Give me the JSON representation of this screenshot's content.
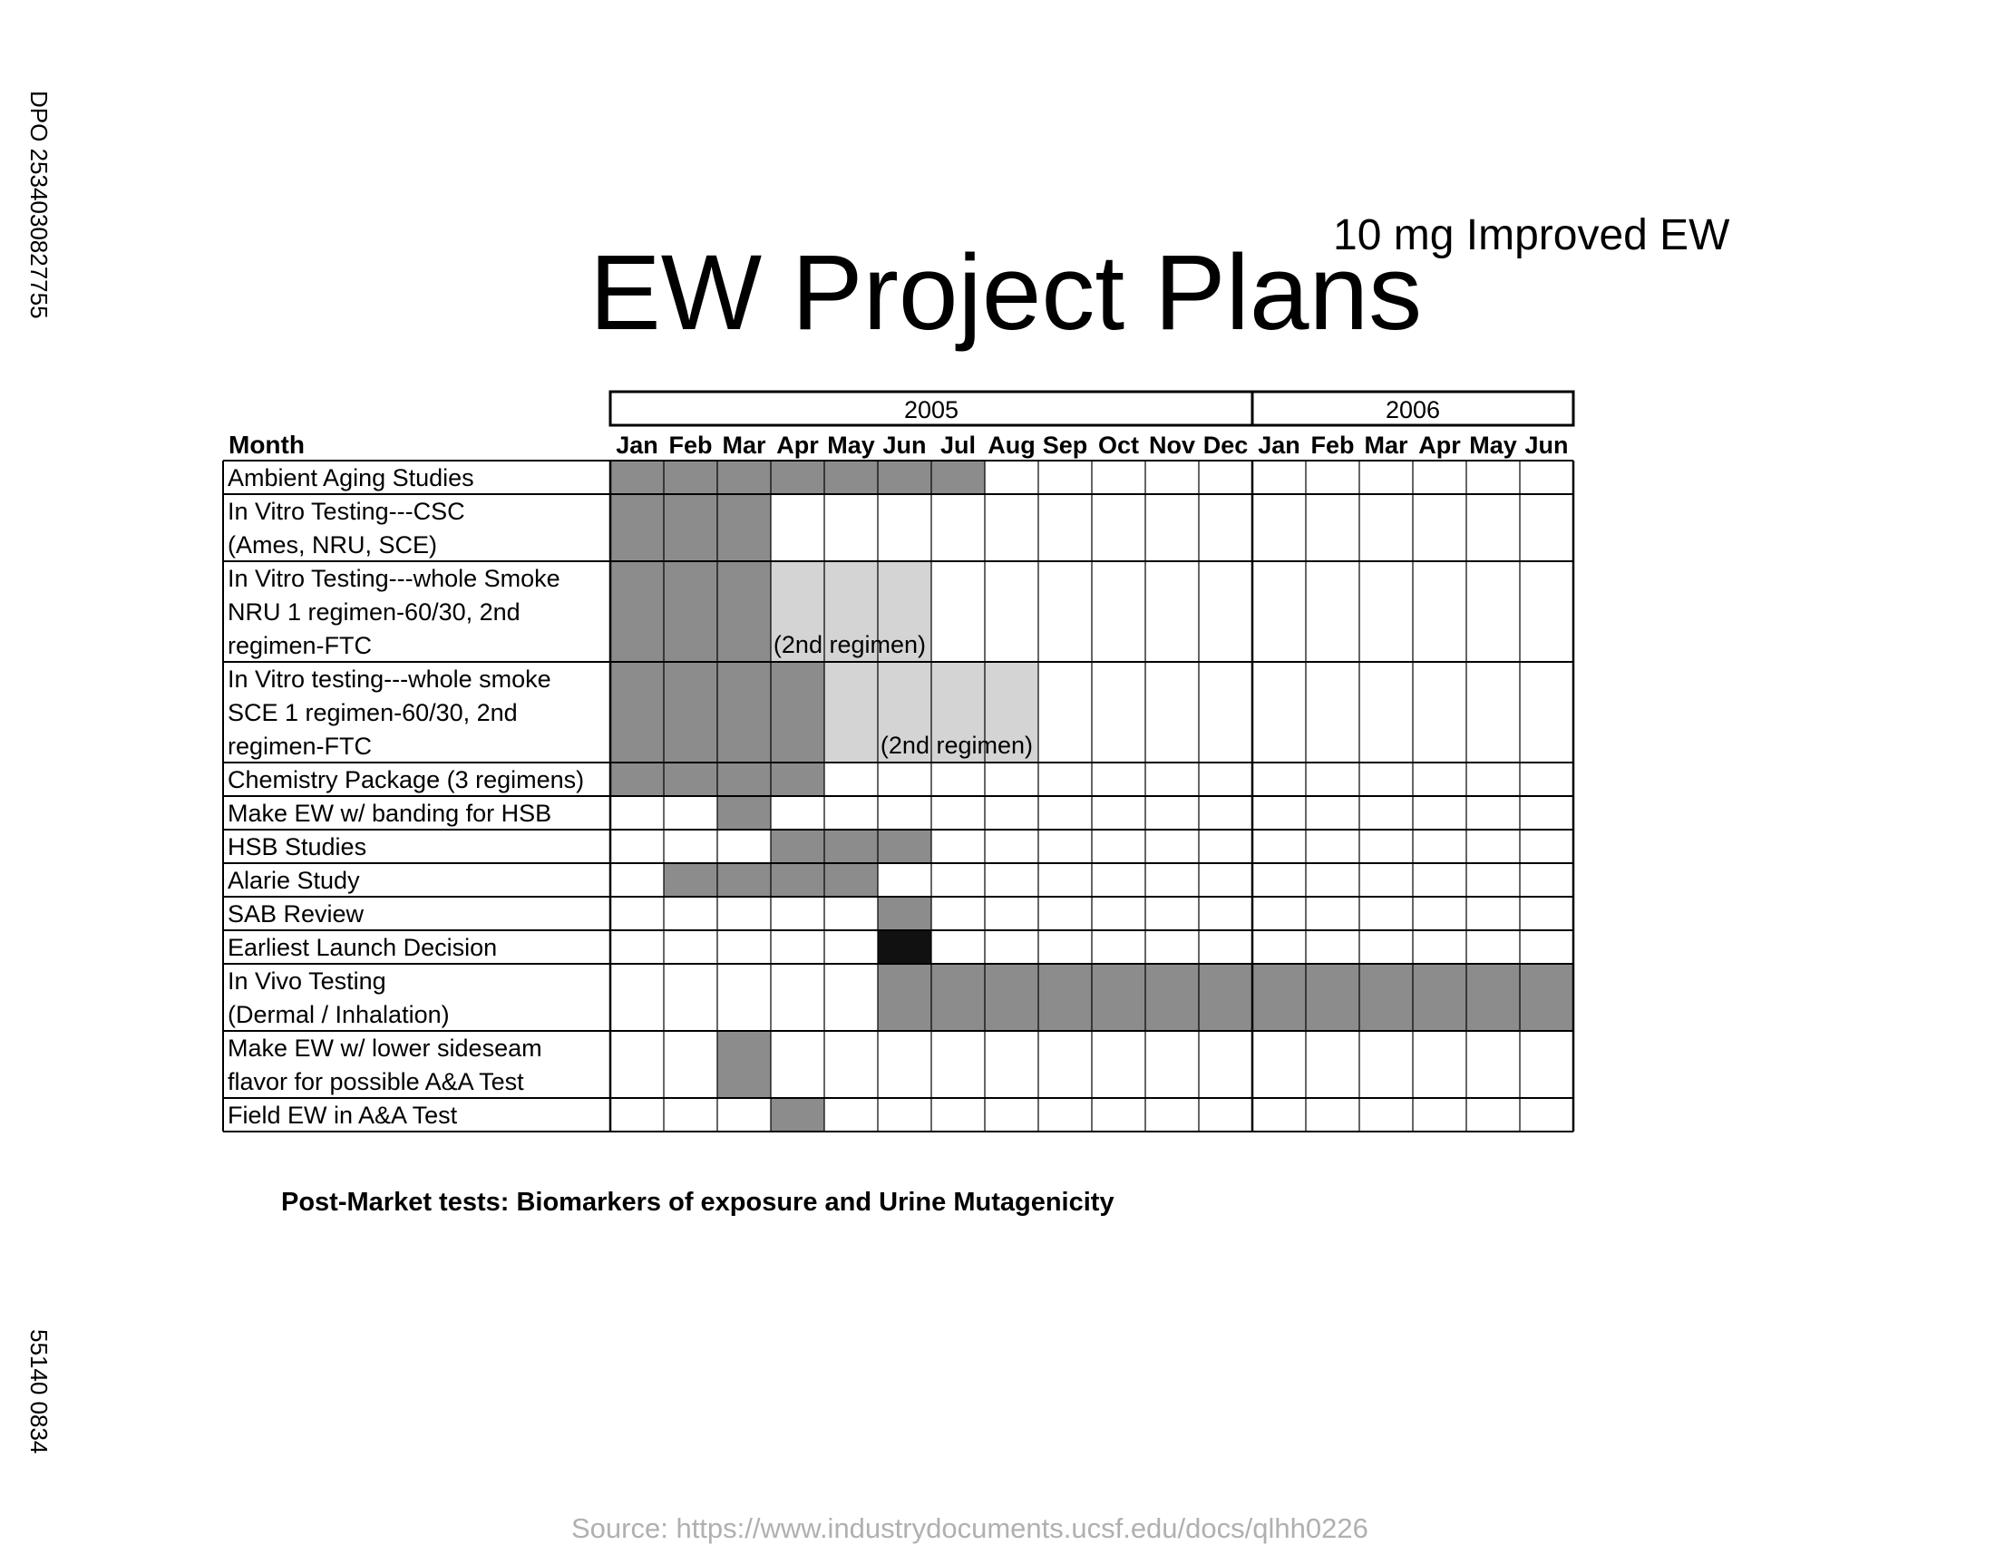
{
  "doc_id_top": "DPO 2534030827755",
  "doc_id_bottom": "55140 0834",
  "subtitle": "10 mg Improved EW",
  "title": "EW Project Plans",
  "table": {
    "month_header": "Month",
    "years": [
      {
        "label": "2005",
        "months": 12
      },
      {
        "label": "2006",
        "months": 6
      }
    ],
    "months": [
      "Jan",
      "Feb",
      "Mar",
      "Apr",
      "May",
      "Jun",
      "Jul",
      "Aug",
      "Sep",
      "Oct",
      "Nov",
      "Dec",
      "Jan",
      "Feb",
      "Mar",
      "Apr",
      "May",
      "Jun"
    ],
    "colors": {
      "dark": "#8c8c8c",
      "light": "#d4d4d4",
      "black": "#111111"
    },
    "rows": [
      {
        "lines": [
          "Ambient Aging Studies"
        ],
        "bars": [
          {
            "start": 0,
            "end": 6,
            "shade": "dark"
          }
        ]
      },
      {
        "lines": [
          "In Vitro Testing---CSC",
          "(Ames, NRU, SCE)"
        ],
        "bars": [
          {
            "start": 0,
            "end": 2,
            "shade": "dark"
          }
        ]
      },
      {
        "lines": [
          "In Vitro Testing---whole Smoke",
          "NRU 1 regimen-60/30, 2nd",
          "regimen-FTC"
        ],
        "bars": [
          {
            "start": 0,
            "end": 2,
            "shade": "dark"
          },
          {
            "start": 3,
            "end": 5,
            "shade": "light",
            "note": "(2nd regimen)"
          }
        ]
      },
      {
        "lines": [
          "In Vitro testing---whole smoke",
          "SCE 1 regimen-60/30, 2nd",
          "regimen-FTC"
        ],
        "bars": [
          {
            "start": 0,
            "end": 3,
            "shade": "dark"
          },
          {
            "start": 4,
            "end": 7,
            "shade": "light",
            "note": "(2nd regimen)"
          }
        ]
      },
      {
        "lines": [
          "Chemistry Package (3 regimens)"
        ],
        "bars": [
          {
            "start": 0,
            "end": 3,
            "shade": "dark"
          }
        ]
      },
      {
        "lines": [
          "Make EW w/ banding for HSB"
        ],
        "bars": [
          {
            "start": 2,
            "end": 2,
            "shade": "dark"
          }
        ]
      },
      {
        "lines": [
          "HSB Studies"
        ],
        "bars": [
          {
            "start": 3,
            "end": 5,
            "shade": "dark"
          }
        ]
      },
      {
        "lines": [
          "Alarie Study"
        ],
        "bars": [
          {
            "start": 1,
            "end": 4,
            "shade": "dark"
          }
        ]
      },
      {
        "lines": [
          "SAB Review"
        ],
        "bars": [
          {
            "start": 5,
            "end": 5,
            "shade": "dark"
          }
        ]
      },
      {
        "lines": [
          "Earliest Launch Decision"
        ],
        "bars": [
          {
            "start": 5,
            "end": 5,
            "shade": "black"
          }
        ]
      },
      {
        "lines": [
          "In Vivo Testing",
          "(Dermal / Inhalation)"
        ],
        "bars": [
          {
            "start": 5,
            "end": 17,
            "shade": "dark"
          }
        ]
      },
      {
        "lines": [
          "Make EW w/ lower sideseam",
          "flavor for possible A&A Test"
        ],
        "bars": [
          {
            "start": 2,
            "end": 2,
            "shade": "dark"
          }
        ]
      },
      {
        "lines": [
          "Field EW in A&A Test"
        ],
        "bars": [
          {
            "start": 3,
            "end": 3,
            "shade": "dark"
          }
        ]
      }
    ]
  },
  "footnote": "Post-Market tests: Biomarkers of exposure and Urine Mutagenicity",
  "source": "Source: https://www.industrydocuments.ucsf.edu/docs/qlhh0226"
}
